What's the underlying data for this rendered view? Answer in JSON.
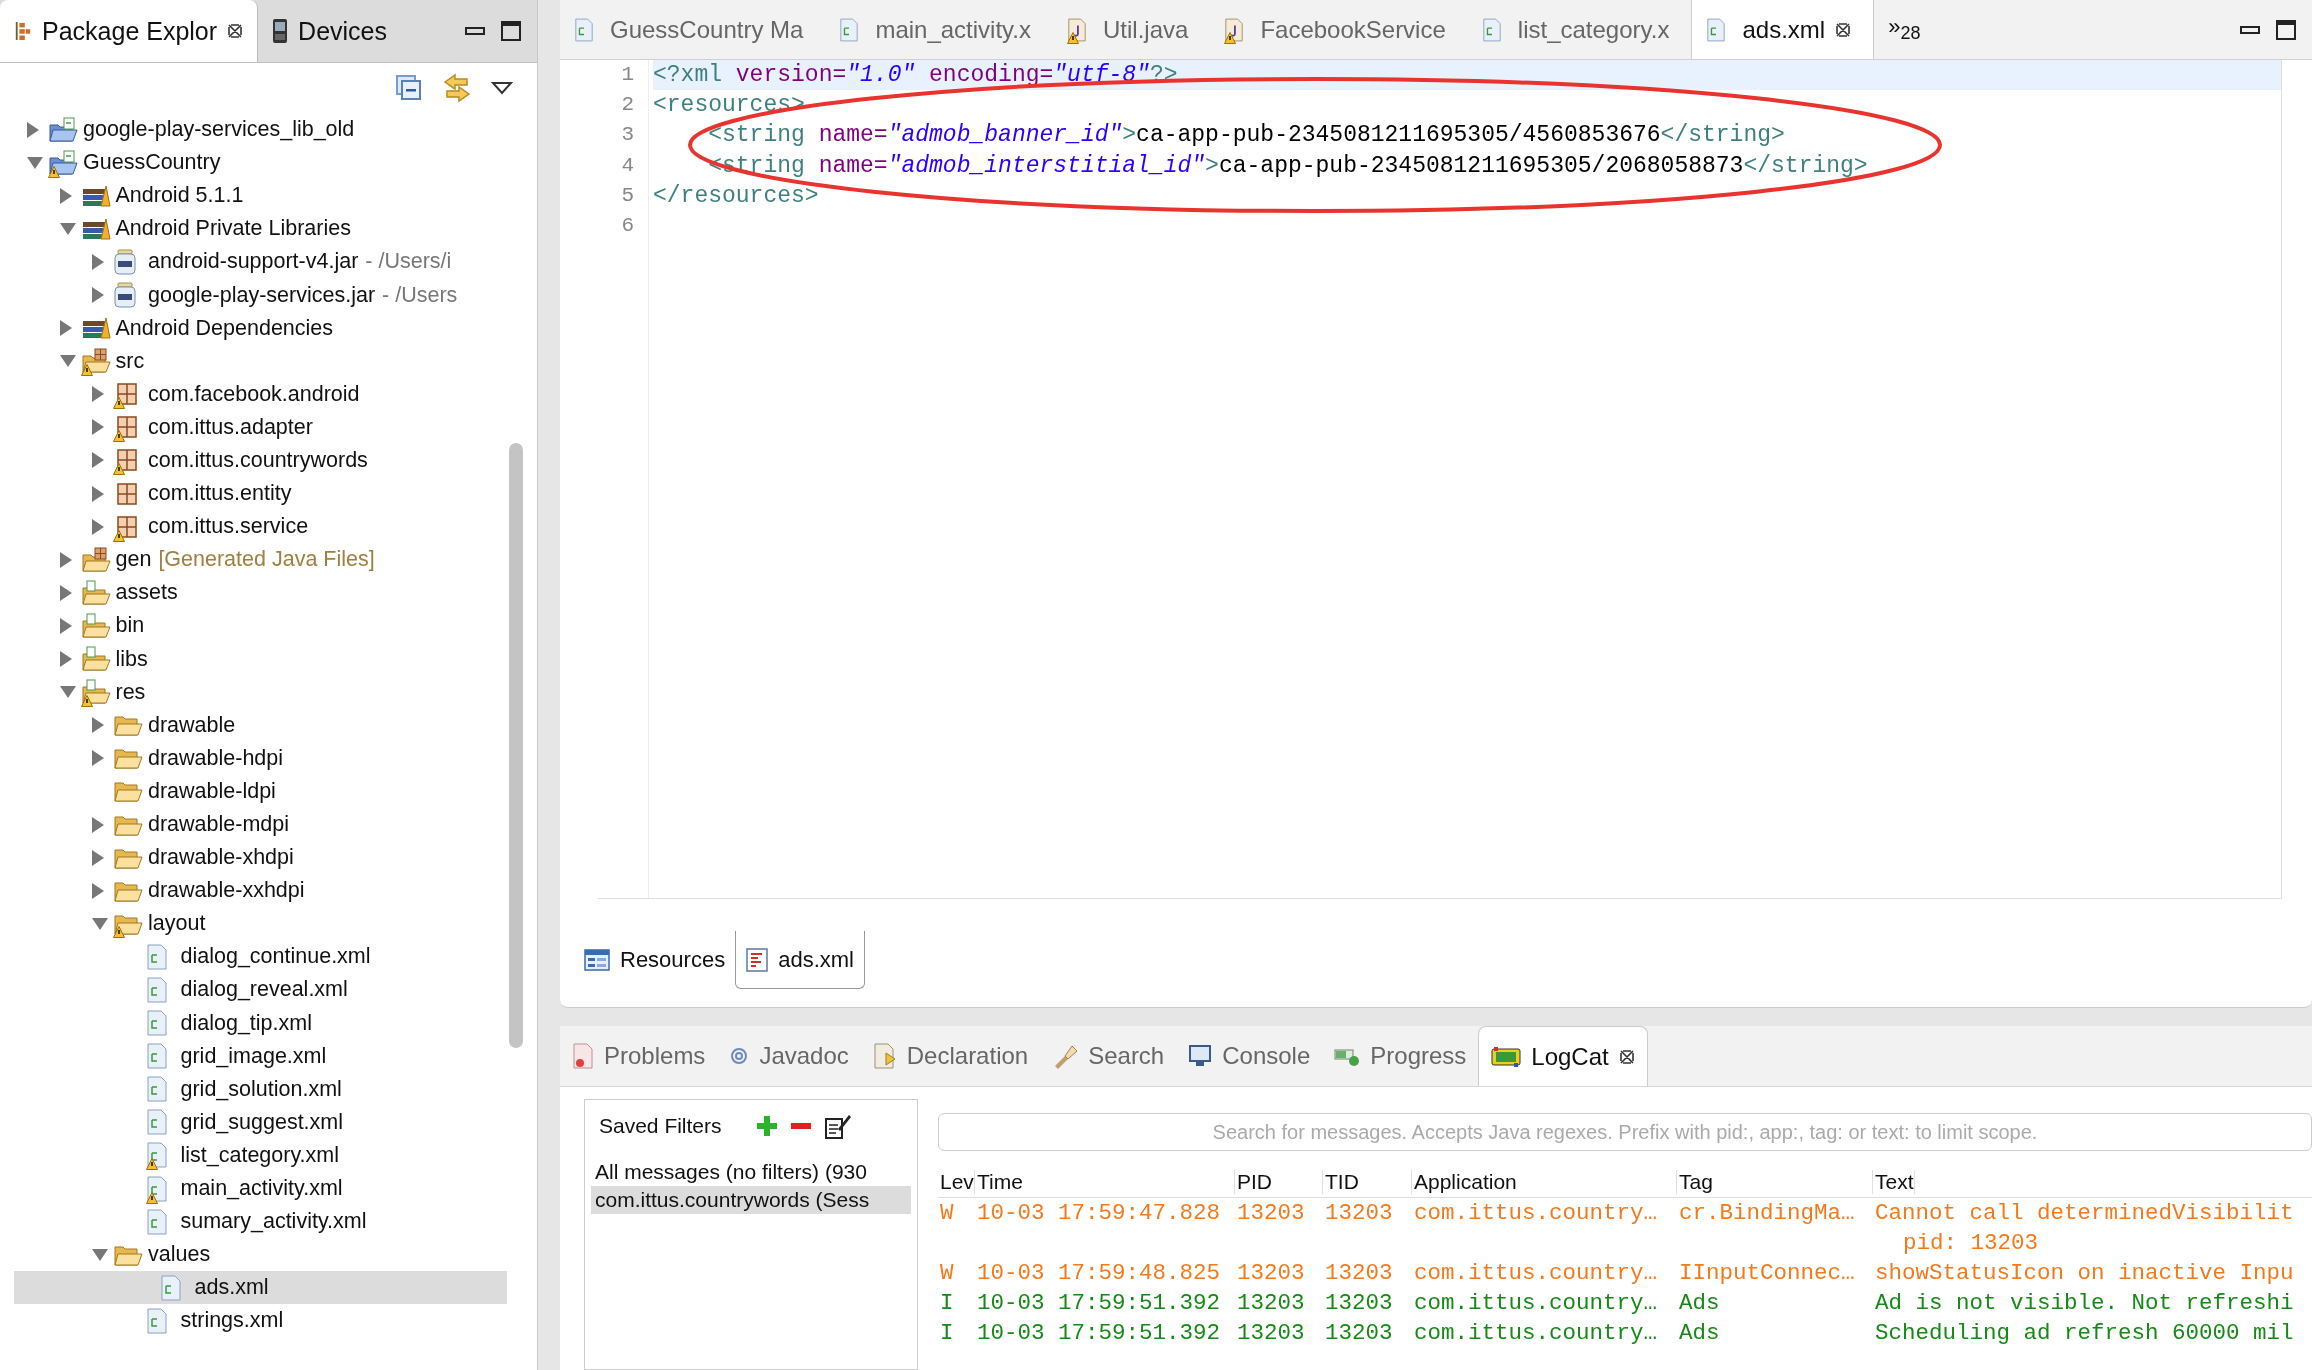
{
  "package_explorer": {
    "tabs": [
      {
        "label": "Package Explor",
        "selected": true,
        "closable": true
      },
      {
        "label": "Devices",
        "selected": false,
        "closable": false
      }
    ],
    "tree": [
      {
        "label": "google-play-services_lib_old",
        "kind": "project",
        "warning": false,
        "selected": false,
        "expanded": false
      },
      {
        "label": "GuessCountry",
        "kind": "project",
        "warning": true,
        "selected": false,
        "expanded": true,
        "children": [
          {
            "label": "Android 5.1.1",
            "kind": "library",
            "warning": false,
            "selected": false,
            "expanded": false
          },
          {
            "label": "Android Private Libraries",
            "kind": "library",
            "warning": false,
            "selected": false,
            "expanded": true,
            "children": [
              {
                "label": "android-support-v4.jar",
                "decoration": {
                  "text": "- /Users/i",
                  "kind": "path"
                },
                "kind": "jar",
                "warning": false,
                "selected": false,
                "expanded": false
              },
              {
                "label": "google-play-services.jar",
                "decoration": {
                  "text": "- /Users",
                  "kind": "path"
                },
                "kind": "jar",
                "warning": false,
                "selected": false,
                "expanded": false
              }
            ]
          },
          {
            "label": "Android Dependencies",
            "kind": "library",
            "warning": false,
            "selected": false,
            "expanded": false
          },
          {
            "label": "src",
            "kind": "source-folder",
            "warning": true,
            "selected": false,
            "expanded": true,
            "children": [
              {
                "label": "com.facebook.android",
                "kind": "package",
                "warning": true,
                "selected": false,
                "expanded": false
              },
              {
                "label": "com.ittus.adapter",
                "kind": "package",
                "warning": true,
                "selected": false,
                "expanded": false
              },
              {
                "label": "com.ittus.countrywords",
                "kind": "package",
                "warning": true,
                "selected": false,
                "expanded": false
              },
              {
                "label": "com.ittus.entity",
                "kind": "package",
                "warning": false,
                "selected": false,
                "expanded": false
              },
              {
                "label": "com.ittus.service",
                "kind": "package",
                "warning": true,
                "selected": false,
                "expanded": false
              }
            ]
          },
          {
            "label": "gen",
            "decoration": {
              "text": "[Generated Java Files]",
              "kind": "generated"
            },
            "kind": "source-folder",
            "warning": false,
            "selected": false,
            "expanded": false
          },
          {
            "label": "assets",
            "kind": "resource-folder",
            "warning": false,
            "selected": false,
            "expanded": false
          },
          {
            "label": "bin",
            "kind": "resource-folder",
            "warning": false,
            "selected": false,
            "expanded": false
          },
          {
            "label": "libs",
            "kind": "resource-folder",
            "warning": false,
            "selected": false,
            "expanded": false
          },
          {
            "label": "res",
            "kind": "resource-folder",
            "warning": true,
            "selected": false,
            "expanded": true,
            "children": [
              {
                "label": "drawable",
                "kind": "folder",
                "warning": false,
                "selected": false,
                "expanded": false
              },
              {
                "label": "drawable-hdpi",
                "kind": "folder",
                "warning": false,
                "selected": false,
                "expanded": false
              },
              {
                "label": "drawable-ldpi",
                "kind": "folder",
                "warning": false,
                "selected": false
              },
              {
                "label": "drawable-mdpi",
                "kind": "folder",
                "warning": false,
                "selected": false,
                "expanded": false
              },
              {
                "label": "drawable-xhdpi",
                "kind": "folder",
                "warning": false,
                "selected": false,
                "expanded": false
              },
              {
                "label": "drawable-xxhdpi",
                "kind": "folder",
                "warning": false,
                "selected": false,
                "expanded": false
              },
              {
                "label": "layout",
                "kind": "folder",
                "warning": true,
                "selected": false,
                "expanded": true,
                "children": [
                  {
                    "label": "dialog_continue.xml",
                    "kind": "xml-file",
                    "warning": false,
                    "selected": false
                  },
                  {
                    "label": "dialog_reveal.xml",
                    "kind": "xml-file",
                    "warning": false,
                    "selected": false
                  },
                  {
                    "label": "dialog_tip.xml",
                    "kind": "xml-file",
                    "warning": false,
                    "selected": false
                  },
                  {
                    "label": "grid_image.xml",
                    "kind": "xml-file",
                    "warning": false,
                    "selected": false
                  },
                  {
                    "label": "grid_solution.xml",
                    "kind": "xml-file",
                    "warning": false,
                    "selected": false
                  },
                  {
                    "label": "grid_suggest.xml",
                    "kind": "xml-file",
                    "warning": false,
                    "selected": false
                  },
                  {
                    "label": "list_category.xml",
                    "kind": "xml-file",
                    "warning": true,
                    "selected": false
                  },
                  {
                    "label": "main_activity.xml",
                    "kind": "xml-file",
                    "warning": true,
                    "selected": false
                  },
                  {
                    "label": "sumary_activity.xml",
                    "kind": "xml-file",
                    "warning": false,
                    "selected": false
                  }
                ]
              },
              {
                "label": "values",
                "kind": "folder",
                "warning": false,
                "selected": false,
                "expanded": true,
                "children": [
                  {
                    "label": "ads.xml",
                    "kind": "xml-file",
                    "warning": false,
                    "selected": true
                  },
                  {
                    "label": "strings.xml",
                    "kind": "xml-file",
                    "warning": false,
                    "selected": false
                  }
                ]
              }
            ]
          }
        ]
      }
    ]
  },
  "editor": {
    "tabs": [
      {
        "label": "GuessCountry Ma",
        "kind": "xml",
        "warning": false,
        "selected": false,
        "closable": false
      },
      {
        "label": "main_activity.x",
        "kind": "xml",
        "warning": false,
        "selected": false,
        "closable": false
      },
      {
        "label": "Util.java",
        "kind": "java",
        "warning": true,
        "selected": false,
        "closable": false
      },
      {
        "label": "FacebookService",
        "kind": "java",
        "warning": true,
        "selected": false,
        "closable": false
      },
      {
        "label": "list_category.x",
        "kind": "xml",
        "warning": false,
        "selected": false,
        "closable": false
      },
      {
        "label": "ads.xml",
        "kind": "xml",
        "warning": false,
        "selected": true,
        "closable": true
      }
    ],
    "overflow": {
      "chevron": "»",
      "count": "28"
    },
    "lines": [
      {
        "number": "1",
        "current": true,
        "tokens": [
          {
            "kind": "tag",
            "text": "<?xml"
          },
          {
            "kind": "attr",
            "text": " version="
          },
          {
            "kind": "value",
            "text": "\"1.0\""
          },
          {
            "kind": "attr",
            "text": " encoding="
          },
          {
            "kind": "value",
            "text": "\"utf-8\""
          },
          {
            "kind": "tag",
            "text": "?>"
          }
        ]
      },
      {
        "number": "2",
        "current": false,
        "tokens": [
          {
            "kind": "tag",
            "text": "<resources>"
          }
        ]
      },
      {
        "number": "3",
        "current": false,
        "tokens": [
          {
            "kind": "tag",
            "text": "    <string"
          },
          {
            "kind": "attr",
            "text": " name="
          },
          {
            "kind": "value",
            "text": "\"admob_banner_id\""
          },
          {
            "kind": "tag",
            "text": ">"
          },
          {
            "kind": "text",
            "text": "ca-app-pub-2345081211695305/4560853676"
          },
          {
            "kind": "tag",
            "text": "</string>"
          }
        ]
      },
      {
        "number": "4",
        "current": false,
        "tokens": [
          {
            "kind": "tag",
            "text": "    <string"
          },
          {
            "kind": "attr",
            "text": " name="
          },
          {
            "kind": "value",
            "text": "\"admob_interstitial_id\""
          },
          {
            "kind": "tag",
            "text": ">"
          },
          {
            "kind": "text",
            "text": "ca-app-pub-2345081211695305/2068058873"
          },
          {
            "kind": "tag",
            "text": "</string>"
          }
        ]
      },
      {
        "number": "5",
        "current": false,
        "tokens": [
          {
            "kind": "tag",
            "text": "</resources>"
          }
        ]
      },
      {
        "number": "6",
        "current": false
      }
    ],
    "bottom_tabs": [
      {
        "label": "Resources",
        "selected": false
      },
      {
        "label": "ads.xml",
        "selected": true
      }
    ]
  },
  "views": {
    "tabs": [
      {
        "label": "Problems",
        "selected": false,
        "closable": false
      },
      {
        "label": "Javadoc",
        "selected": false,
        "closable": false
      },
      {
        "label": "Declaration",
        "selected": false,
        "closable": false
      },
      {
        "label": "Search",
        "selected": false,
        "closable": false
      },
      {
        "label": "Console",
        "selected": false,
        "closable": false
      },
      {
        "label": "Progress",
        "selected": false,
        "closable": false
      },
      {
        "label": "LogCat",
        "selected": true,
        "closable": true
      }
    ],
    "saved_filters": {
      "title": "Saved Filters",
      "items": [
        {
          "label": "All messages (no filters) (930",
          "selected": false
        },
        {
          "label": "com.ittus.countrywords (Sess",
          "selected": true
        }
      ]
    },
    "search": {
      "placeholder": "Search for messages. Accepts Java regexes. Prefix with pid:, app:, tag: or text: to limit scope."
    },
    "columns": [
      "Lev",
      "Time",
      "PID",
      "TID",
      "Application",
      "Tag",
      "Text"
    ],
    "rows": [
      {
        "priority": "W",
        "time": "10-03 17:59:47.828",
        "pid": "13203",
        "tid": "13203",
        "application": "com.ittus.country…",
        "tag": "cr.BindingMa…",
        "text": "Cannot call determinedVisibilit",
        "continuation": "pid: 13203"
      },
      {
        "priority": "W",
        "time": "10-03 17:59:48.825",
        "pid": "13203",
        "tid": "13203",
        "application": "com.ittus.country…",
        "tag": "IInputConnec…",
        "text": "showStatusIcon on inactive Inpu"
      },
      {
        "priority": "I",
        "time": "10-03 17:59:51.392",
        "pid": "13203",
        "tid": "13203",
        "application": "com.ittus.country…",
        "tag": "Ads",
        "text": "Ad is not visible. Not refreshi"
      },
      {
        "priority": "I",
        "time": "10-03 17:59:51.392",
        "pid": "13203",
        "tid": "13203",
        "application": "com.ittus.country…",
        "tag": "Ads",
        "text": "Scheduling ad refresh 60000 mil"
      }
    ]
  }
}
